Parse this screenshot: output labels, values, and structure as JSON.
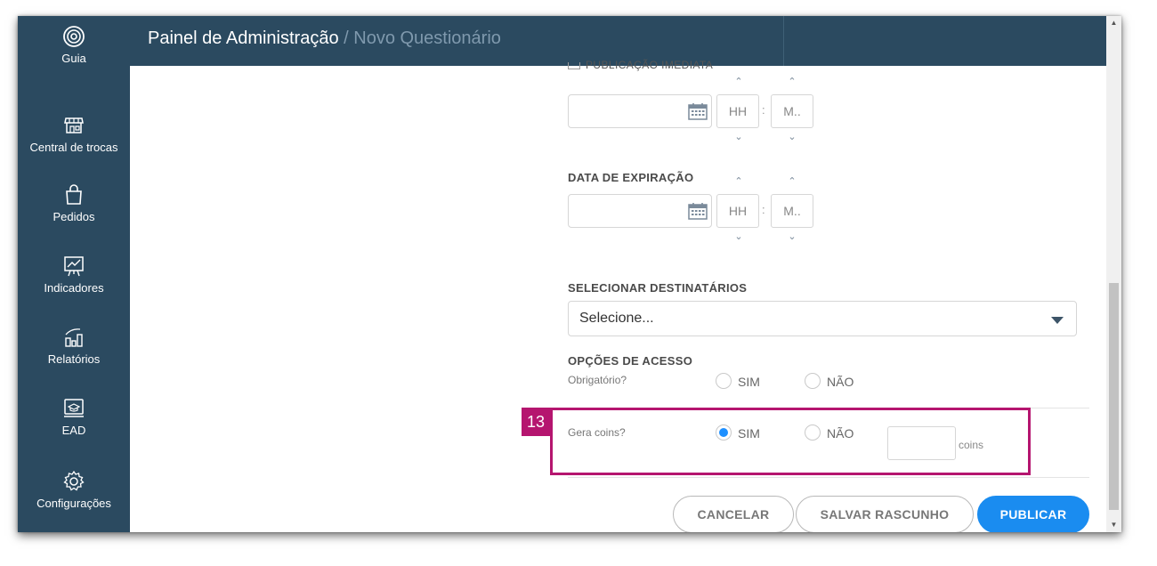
{
  "header": {
    "title": "Painel de Administração",
    "breadcrumb": " / Novo Questionário"
  },
  "sidebar": {
    "items": [
      {
        "label": "Guia",
        "icon": "guide-icon"
      },
      {
        "label": "Central de trocas",
        "icon": "store-icon"
      },
      {
        "label": "Pedidos",
        "icon": "bag-icon"
      },
      {
        "label": "Indicadores",
        "icon": "chart-board-icon"
      },
      {
        "label": "Relatórios",
        "icon": "report-icon"
      },
      {
        "label": "EAD",
        "icon": "ead-icon"
      },
      {
        "label": "Configurações",
        "icon": "gear-icon"
      }
    ]
  },
  "form": {
    "cut_label": "PUBLICAÇÃO IMEDIATA",
    "publish_time": {
      "hour_placeholder": "HH",
      "minute_placeholder": "M..",
      "separator": ":"
    },
    "expiration": {
      "label": "DATA DE EXPIRAÇÃO",
      "hour_placeholder": "HH",
      "minute_placeholder": "M..",
      "separator": ":"
    },
    "recipients": {
      "label": "SELECIONAR DESTINATÁRIOS",
      "selected": "Selecione..."
    },
    "access": {
      "label": "OPÇÕES DE ACESSO",
      "mandatory_label": "Obrigatório?",
      "yes": "SIM",
      "no": "NÃO",
      "mandatory_value": null
    },
    "coins": {
      "label": "Gera coins?",
      "yes": "SIM",
      "no": "NÃO",
      "value": "SIM",
      "unit": "coins",
      "amount": ""
    }
  },
  "annotation": {
    "step": "13",
    "color": "#b5156f"
  },
  "buttons": {
    "cancel": "CANCELAR",
    "save_draft": "SALVAR RASCUNHO",
    "publish": "PUBLICAR"
  },
  "colors": {
    "sidebar": "#2b4a60",
    "primary": "#1a8cf0"
  }
}
